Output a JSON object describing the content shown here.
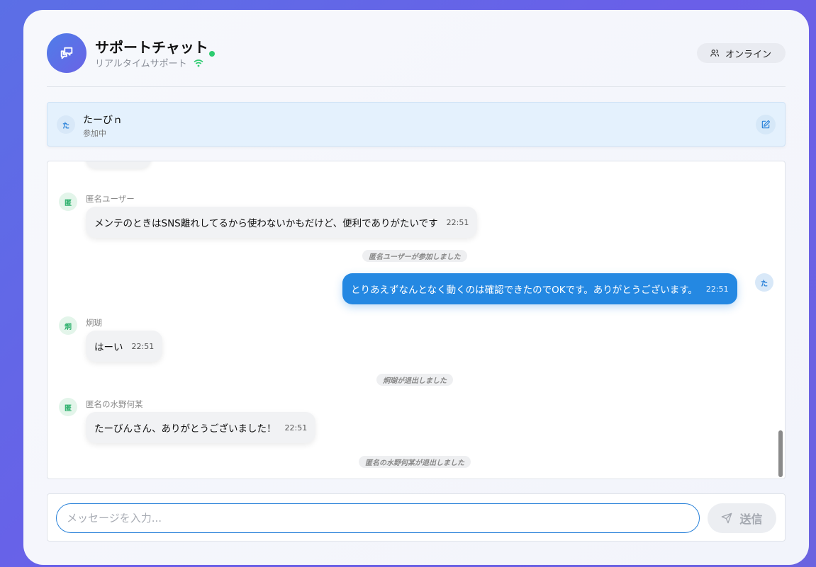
{
  "header": {
    "title": "サポートチャット",
    "subtitle": "リアルタイムサポート",
    "online_label": "オンライン"
  },
  "user": {
    "avatar": "た",
    "name": "たーびｎ",
    "status": "参加中"
  },
  "messages": [
    {
      "avatar": "匿",
      "name": "匿名ユーザー",
      "text": "メンテのときはSNS離れしてるから使わないかもだけど、便利でありがたいです",
      "time": "22:51"
    },
    {
      "system": "匿名ユーザーが参加しました"
    },
    {
      "avatar": "た",
      "text": "とりあえずなんとなく動くのは確認できたのでOKです。ありがとうございます。",
      "time": "22:51",
      "mine": true
    },
    {
      "avatar": "炯",
      "name": "炯瑚",
      "text": "はーい",
      "time": "22:51"
    },
    {
      "system": "炯瑚が退出しました"
    },
    {
      "avatar": "匿",
      "name": "匿名の水野何某",
      "text": "たーびんさん、ありがとうございました！",
      "time": "22:51"
    },
    {
      "system": "匿名の水野何某が退出しました"
    }
  ],
  "composer": {
    "placeholder": "メッセージを入力...",
    "send_label": "送信"
  },
  "colors": {
    "accent": "#2488e2",
    "online_dot": "#2ecc71",
    "avatar_green": "#2bb06b"
  }
}
